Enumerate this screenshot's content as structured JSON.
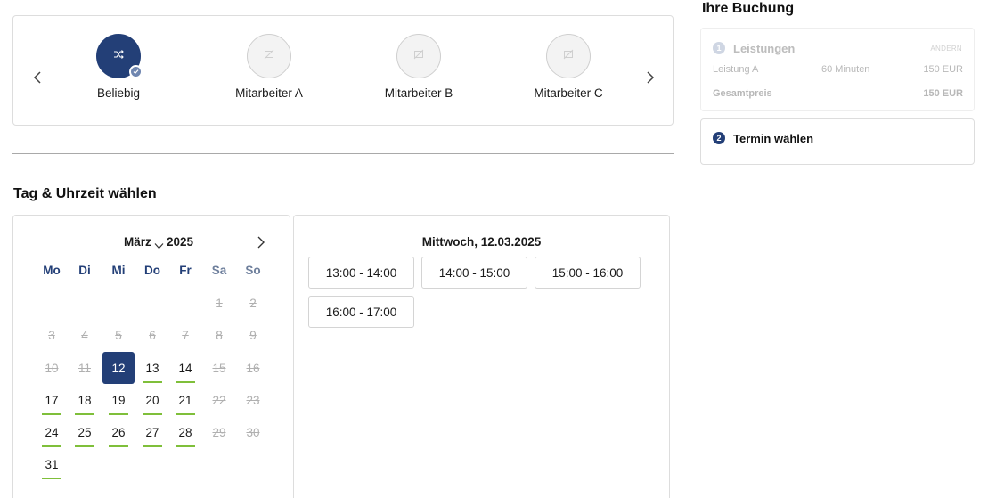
{
  "staff": {
    "items": [
      {
        "name": "Beliebig",
        "selected": true,
        "icon": "shuffle-icon"
      },
      {
        "name": "Mitarbeiter A",
        "selected": false,
        "icon": "no-image-icon"
      },
      {
        "name": "Mitarbeiter B",
        "selected": false,
        "icon": "no-image-icon"
      },
      {
        "name": "Mitarbeiter C",
        "selected": false,
        "icon": "no-image-icon"
      }
    ]
  },
  "section": {
    "title": "Tag & Uhrzeit wählen"
  },
  "calendar": {
    "month": "März",
    "year": "2025",
    "weekdays": [
      "Mo",
      "Di",
      "Mi",
      "Do",
      "Fr",
      "Sa",
      "So"
    ],
    "selected_day": "12",
    "weeks": [
      [
        null,
        null,
        null,
        null,
        null,
        {
          "d": "1",
          "s": "dis"
        },
        {
          "d": "2",
          "s": "dis"
        }
      ],
      [
        {
          "d": "3",
          "s": "dis"
        },
        {
          "d": "4",
          "s": "dis"
        },
        {
          "d": "5",
          "s": "dis"
        },
        {
          "d": "6",
          "s": "dis"
        },
        {
          "d": "7",
          "s": "dis"
        },
        {
          "d": "8",
          "s": "dis"
        },
        {
          "d": "9",
          "s": "dis"
        }
      ],
      [
        {
          "d": "10",
          "s": "dis"
        },
        {
          "d": "11",
          "s": "dis"
        },
        {
          "d": "12",
          "s": "sel"
        },
        {
          "d": "13",
          "s": "av"
        },
        {
          "d": "14",
          "s": "av"
        },
        {
          "d": "15",
          "s": "dis"
        },
        {
          "d": "16",
          "s": "dis"
        }
      ],
      [
        {
          "d": "17",
          "s": "av"
        },
        {
          "d": "18",
          "s": "av"
        },
        {
          "d": "19",
          "s": "av"
        },
        {
          "d": "20",
          "s": "av"
        },
        {
          "d": "21",
          "s": "av"
        },
        {
          "d": "22",
          "s": "dis"
        },
        {
          "d": "23",
          "s": "dis"
        }
      ],
      [
        {
          "d": "24",
          "s": "av"
        },
        {
          "d": "25",
          "s": "av"
        },
        {
          "d": "26",
          "s": "av"
        },
        {
          "d": "27",
          "s": "av"
        },
        {
          "d": "28",
          "s": "av"
        },
        {
          "d": "29",
          "s": "dis"
        },
        {
          "d": "30",
          "s": "dis"
        }
      ],
      [
        {
          "d": "31",
          "s": "av"
        },
        null,
        null,
        null,
        null,
        null,
        null
      ]
    ]
  },
  "slots": {
    "date": "Mittwoch, 12.03.2025",
    "times": [
      "13:00 - 14:00",
      "14:00 - 15:00",
      "15:00 - 16:00",
      "16:00 - 17:00"
    ]
  },
  "booking": {
    "title": "Ihre Buchung",
    "services": {
      "step": "1",
      "title": "Leistungen",
      "edit": "ÄNDERN",
      "service_name": "Leistung A",
      "duration": "60 Minuten",
      "price": "150 EUR",
      "total_label": "Gesamtpreis",
      "total": "150 EUR"
    },
    "termin": {
      "step": "2",
      "title": "Termin wählen"
    }
  },
  "colors": {
    "primary": "#233f77",
    "available_underline": "#7fbf3a",
    "disabled": "#b0b0b0"
  }
}
